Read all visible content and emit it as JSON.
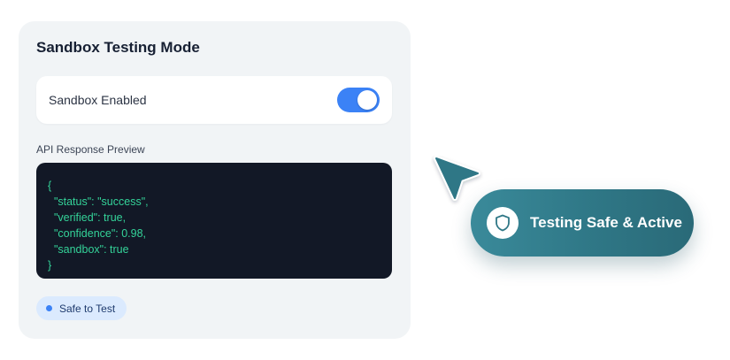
{
  "card": {
    "title": "Sandbox Testing Mode",
    "toggle": {
      "label": "Sandbox Enabled",
      "enabled": true,
      "color": "#3b82f6"
    },
    "preview_label": "API Response Preview",
    "code_lines": [
      "{",
      "  \"status\": \"success\",",
      "  \"verified\": true,",
      "  \"confidence\": 0.98,",
      "  \"sandbox\": true",
      "}"
    ],
    "badge": {
      "label": "Safe to Test",
      "color": "#3b82f6"
    }
  },
  "cursor": {
    "icon": "arrow-cursor-icon",
    "color": "#2f7786"
  },
  "status_pill": {
    "icon": "shield-icon",
    "label": "Testing Safe & Active",
    "color": "#2f7786"
  }
}
